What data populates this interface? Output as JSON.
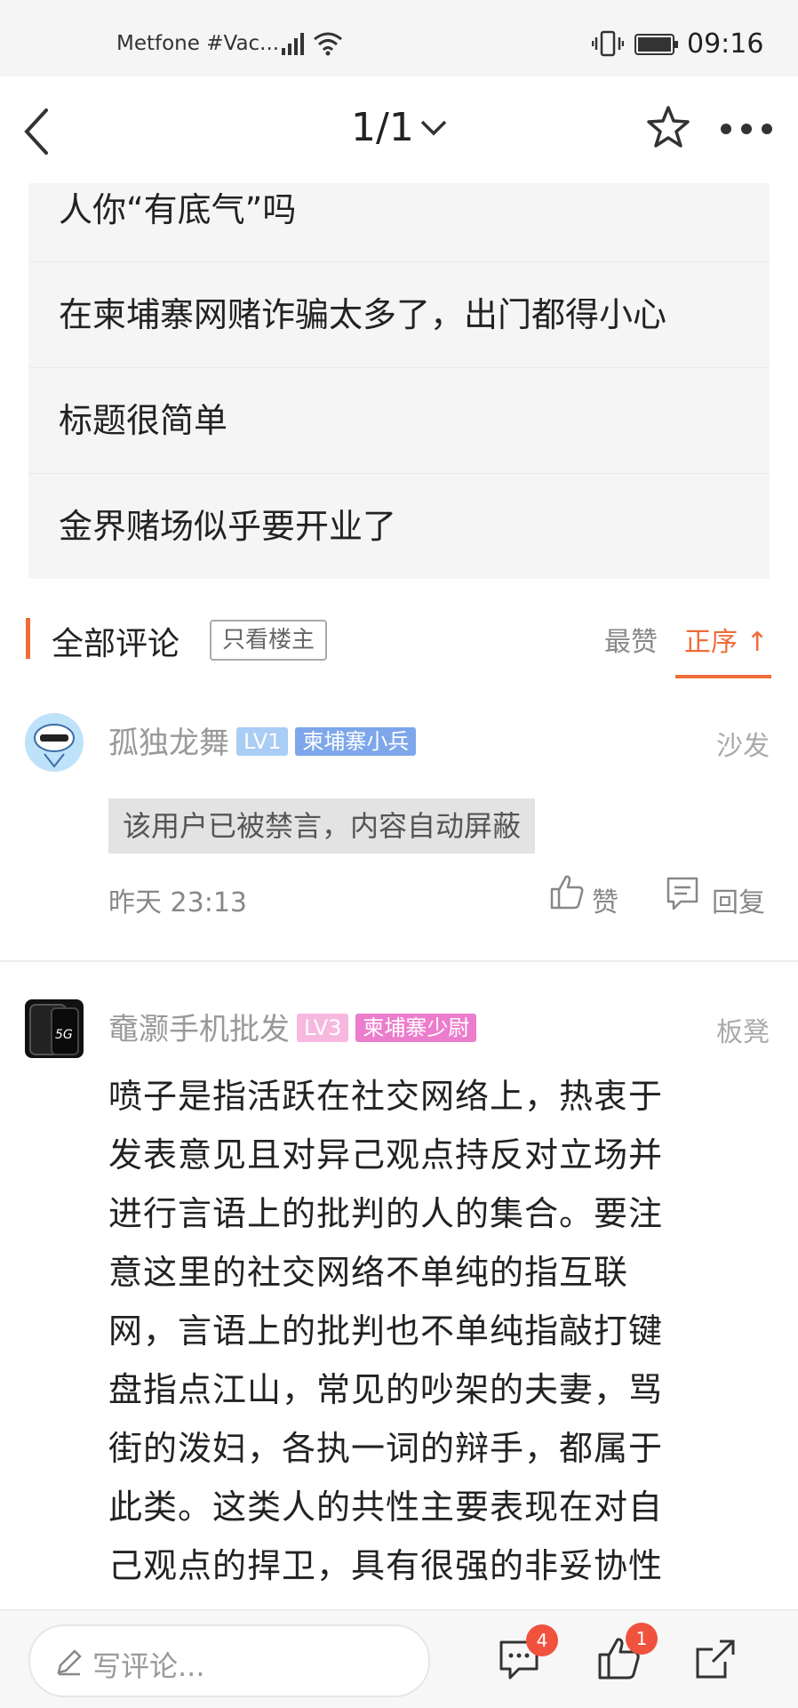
{
  "status_bar": {
    "carrier": "Metfone #Vac...",
    "time": "09:16"
  },
  "nav": {
    "pager": "1/1"
  },
  "related_posts": [
    {
      "title": "人你“有底气”吗"
    },
    {
      "title": "在柬埔寨网赌诈骗太多了，出门都得小心"
    },
    {
      "title": "标题很简单"
    },
    {
      "title": "金界赌场似乎要开业了"
    }
  ],
  "comments_header": {
    "title": "全部评论",
    "only_op": "只看楼主",
    "sort_hot": "最赞",
    "sort_order": "正序 ↑"
  },
  "comments": [
    {
      "username": "孤独龙舞",
      "level": "LV1",
      "title_badge": "柬埔寨小兵",
      "floor": "沙发",
      "content": "该用户已被禁言，内容自动屏蔽",
      "time": "昨天 23:13",
      "like_label": "赞",
      "reply_label": "回复"
    },
    {
      "username": "鼀灏手机批发",
      "level": "LV3",
      "title_badge": "柬埔寨少尉",
      "floor": "板凳",
      "content_lines": [
        "喷子是指活跃在社交网络上，热衷于",
        "发表意见且对异己观点持反对立场并",
        "进行言语上的批判的人的集合。要注",
        "意这里的社交网络不单纯的指互联",
        "网，言语上的批判也不单纯指敲打键",
        "盘指点江山，常见的吵架的夫妻，骂",
        "街的泼妇，各执一词的辩手，都属于",
        "此类。这类人的共性主要表现在对自",
        "己观点的捍卫，具有很强的非妥协性"
      ]
    }
  ],
  "bottom_bar": {
    "placeholder": "写评论...",
    "comment_count": "4",
    "like_count": "1"
  },
  "colors": {
    "accent": "#ee6c3a",
    "badge_red": "#f0523e",
    "lv1": "#a9cdf5",
    "tag_blue": "#7ea6ea",
    "lv3": "#f6b8df",
    "tag_pink": "#ec7ccc"
  }
}
